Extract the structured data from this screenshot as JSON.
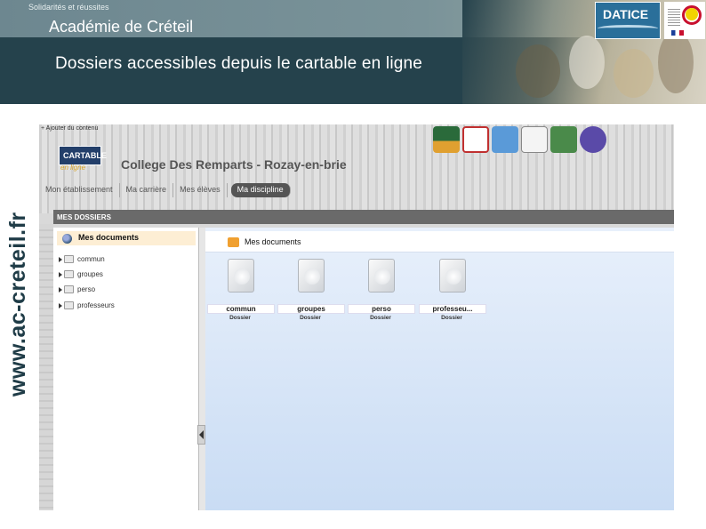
{
  "header": {
    "tagline": "Solidarités et réussites",
    "academy": "Académie de Créteil",
    "title": "Dossiers accessibles depuis le cartable en ligne",
    "logo_datice": "DATICE"
  },
  "side_url": "www.ac-creteil.fr",
  "app": {
    "add_content": "+ Ajouter du contenu",
    "logo": "CARTABLE",
    "logo_sub": "en ligne",
    "school": "College Des Remparts - Rozay-en-brie",
    "toolbar_icons": [
      "notebook-icon",
      "calendar-icon",
      "folders-icon",
      "mail-icon",
      "edit-icon",
      "help-icon"
    ],
    "nav": [
      "Mon établissement",
      "Ma carrière",
      "Mes élèves",
      "Ma discipline"
    ],
    "nav_active": "Ma discipline",
    "section": "MES DOSSIERS",
    "tree": {
      "root": "Mes documents",
      "items": [
        "commun",
        "groupes",
        "perso",
        "professeurs"
      ]
    },
    "content": {
      "title": "Mes documents",
      "files": [
        {
          "name": "commun",
          "type": "Dossier"
        },
        {
          "name": "groupes",
          "type": "Dossier"
        },
        {
          "name": "perso",
          "type": "Dossier"
        },
        {
          "name": "professeu...",
          "type": "Dossier"
        }
      ]
    }
  }
}
